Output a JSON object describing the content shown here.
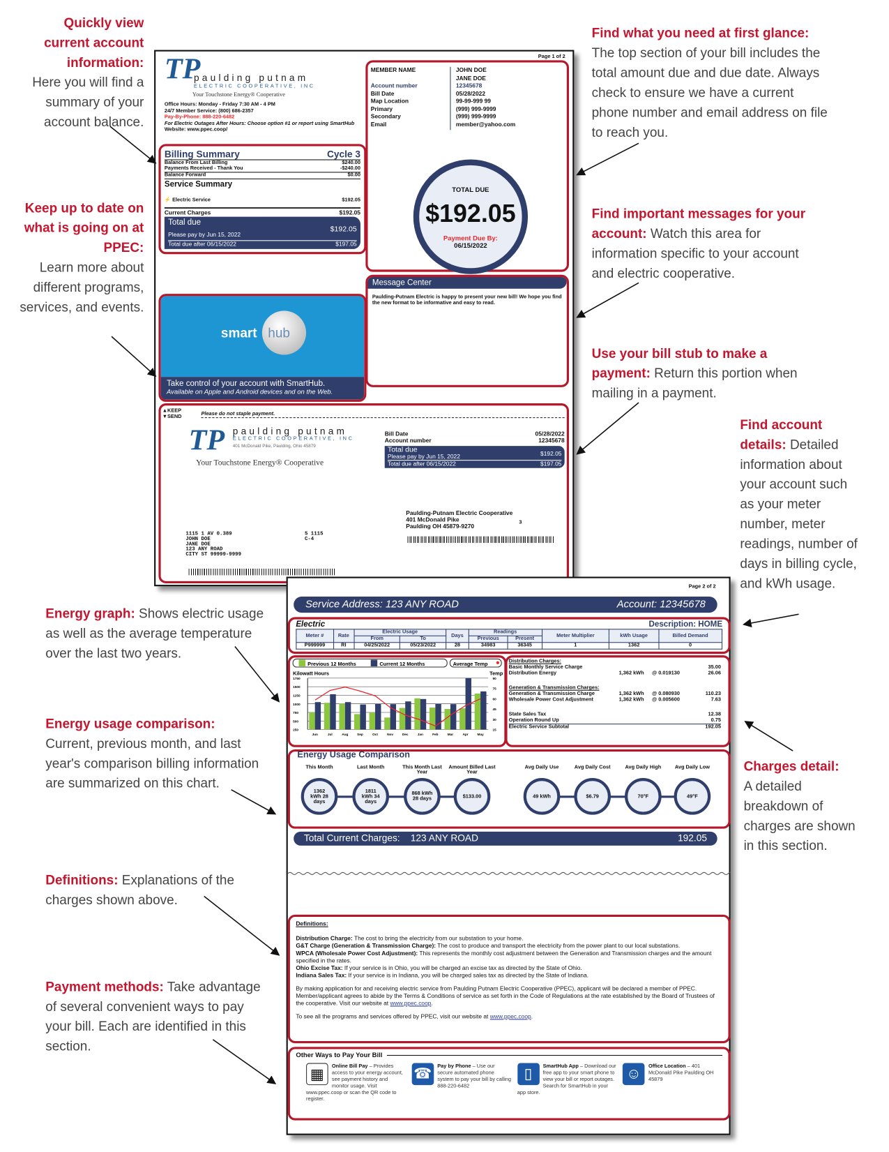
{
  "annotations": {
    "account": {
      "heading": "Quickly view current account information:",
      "text": "Here you will find a summary of your account balance."
    },
    "ppec": {
      "heading": "Keep up to date on what is going on at PPEC:",
      "text": "Learn more about different programs, services, and events."
    },
    "glance": {
      "heading": "Find what you need at first glance:",
      "text": "The top section of your bill includes the total amount due and due date. Always check to ensure we have a current phone number and email address on file to reach you."
    },
    "messages": {
      "heading": "Find important messages for your account:",
      "text": "Watch this area for information specific to your account and electric cooperative."
    },
    "stub": {
      "heading": "Use your bill stub to make a payment:",
      "text": "Return this portion when mailing in a payment."
    },
    "details": {
      "heading": "Find account details:",
      "text": "Detailed information about your account such as your meter number, meter readings, number of days in billing cycle, and kWh usage."
    },
    "graph": {
      "heading": "Energy graph:",
      "text": "Shows electric usage as well as the average temperature over the last two years."
    },
    "comparison": {
      "heading": "Energy usage comparison:",
      "text": "Current, previous month, and last year's comparison billing information are summarized on this chart."
    },
    "charges": {
      "heading": "Charges detail:",
      "text": "A detailed breakdown of charges are shown in this section."
    },
    "definitions": {
      "heading": "Definitions:",
      "text": "Explanations of the charges shown above."
    },
    "payment": {
      "heading": "Payment methods:",
      "text": "Take advantage of several convenient ways to pay your bill. Each are identified in this section."
    }
  },
  "colors": {
    "accent_red": "#b5172b",
    "navy": "#2f3e6b",
    "logo_blue": "#1f5a94",
    "smarthub_blue": "#1e96d3",
    "prev_green": "#8cc63f"
  },
  "page1": {
    "page_label": "Page 1 of 2",
    "logo": {
      "name": "paulding putnam",
      "sub": "ELECTRIC COOPERATIVE, INC",
      "tagline": "Your Touchstone Energy® Cooperative"
    },
    "office_hours": "Office Hours: Monday - Friday 7:30 AM - 4 PM",
    "member_service": "24/7 Member Service: (800) 686-2357",
    "pay_by_phone": "Pay-By-Phone: 888-220-6482",
    "outages": "For Electric Outages After Hours: Choose option #1 or report using SmartHub",
    "website": "Website: www.ppec.coop/",
    "member": {
      "rows": [
        {
          "label": "MEMBER NAME",
          "value": "JOHN DOE"
        },
        {
          "label": "",
          "value": "JANE DOE"
        },
        {
          "label": "Account number",
          "value": "12345678"
        },
        {
          "label": "Bill Date",
          "value": "05/28/2022"
        },
        {
          "label": "Map Location",
          "value": "99-99-999 99"
        },
        {
          "label": "Primary",
          "value": "(999) 999-9999"
        },
        {
          "label": "Secondary",
          "value": "(999) 999-9999"
        },
        {
          "label": "Email",
          "value": "member@yahoo.com"
        }
      ]
    },
    "total_due": {
      "label": "TOTAL DUE",
      "amount": "$192.05",
      "due_label": "Payment Due By:",
      "due_date": "06/15/2022"
    },
    "billing": {
      "title": "Billing Summary",
      "cycle": "Cycle 3",
      "lines": [
        {
          "label": "Balance From Last Billing",
          "value": "$240.00"
        },
        {
          "label": "Payments Received - Thank You",
          "value": "-$240.00"
        },
        {
          "label": "Balance Forward",
          "value": "$0.00"
        }
      ],
      "service_title": "Service Summary",
      "service": {
        "label": "Electric Service",
        "value": "$192.05"
      },
      "current": {
        "label": "Current Charges",
        "value": "$192.05"
      },
      "total_label": "Total due",
      "total_value": "$192.05",
      "pay_by": "Please pay by Jun 15, 2022",
      "after_label": "Total due after 06/15/2022",
      "after_value": "$197.05"
    },
    "smarthub": {
      "word1": "smart",
      "word2": "hub",
      "line1": "Take control of your account with SmartHub.",
      "line2": "Available on Apple and Android devices and on the Web."
    },
    "message_center": {
      "title": "Message Center",
      "text": "Paulding-Putnam Electric is happy to present your new bill! We hope you find the new format to be informative and easy to read."
    },
    "stub": {
      "keep": "KEEP",
      "send": "SEND",
      "no_staple": "Please do not staple payment.",
      "address": "401 McDonald Pike, Paulding, Ohio 45879",
      "bill_date_label": "Bill Date",
      "bill_date": "05/28/2022",
      "account_label": "Account number",
      "account": "12345678",
      "total_label": "Total due",
      "total_value": "$192.05",
      "pay_by": "Please pay by Jun 15, 2022",
      "after_label": "Total due after 06/15/2022",
      "after_value": "$197.05",
      "remit": [
        "Paulding-Putnam Electric Cooperative",
        "401 McDonald Pike",
        "Paulding OH 45879-9270"
      ],
      "remit_code": "3",
      "mail": [
        "1115  1 AV 0.389",
        "JOHN DOE",
        "JANE DOE",
        "123 ANY ROAD",
        "CITY ST 99999-9999"
      ],
      "mail_code": [
        "5 1115",
        "C-4"
      ]
    }
  },
  "page2": {
    "page_label": "Page 2 of 2",
    "service_address": "Service Address: 123 ANY ROAD",
    "account": "Account: 12345678",
    "electric": {
      "title": "Electric",
      "description": "Description: HOME",
      "headers": {
        "meter": "Meter #",
        "rate": "Rate",
        "usage": "Electric Usage",
        "from": "From",
        "to": "To",
        "days": "Days",
        "readings": "Readings",
        "previous": "Previous",
        "present": "Present",
        "multiplier": "Meter Multiplier",
        "kwh": "kWh Usage",
        "demand": "Billed Demand"
      },
      "values": {
        "meter": "P999999",
        "rate": "RI",
        "from": "04/25/2022",
        "to": "05/23/2022",
        "days": "28",
        "previous": "34983",
        "present": "36345",
        "multiplier": "1",
        "kwh": "1362",
        "demand": "0"
      }
    },
    "charges": {
      "dist_title": "Distribution Charges:",
      "dist": [
        {
          "label": "Basic Monthly Service Charge",
          "qty": "",
          "rate": "",
          "value": "35.00"
        },
        {
          "label": "Distribution Energy",
          "qty": "1,362 kWh",
          "rate": "@ 0.019130",
          "value": "26.06"
        }
      ],
      "gt_title": "Generation & Transmission Charges:",
      "gt": [
        {
          "label": "Generation & Transmission Charge",
          "qty": "1,362 kWh",
          "rate": "@ 0.080930",
          "value": "110.23"
        },
        {
          "label": "Wholesale Power Cost Adjustment",
          "qty": "1,362 kWh",
          "rate": "@ 0.005600",
          "value": "7.63"
        }
      ],
      "other": [
        {
          "label": "State Sales Tax",
          "value": "12.38"
        },
        {
          "label": "Operation Round Up",
          "value": "0.75"
        }
      ],
      "subtotal": {
        "label": "Electric Service Subtotal",
        "value": "192.05"
      }
    },
    "comparison": {
      "title": "Energy Usage Comparison",
      "items": [
        {
          "label": "This Month",
          "value": "1362 kWh 28 days"
        },
        {
          "label": "Last Month",
          "value": "1811 kWh 34 days"
        },
        {
          "label": "This Month Last Year",
          "value": "868 kWh 28 days"
        },
        {
          "label": "Amount Billed Last Year",
          "value": "$133.00"
        },
        {
          "label": "Avg Daily Use",
          "value": "49 kWh"
        },
        {
          "label": "Avg Daily Cost",
          "value": "$6.79"
        },
        {
          "label": "Avg Daily High",
          "value": "70°F"
        },
        {
          "label": "Avg Daily Low",
          "value": "49°F"
        }
      ]
    },
    "total_charges": {
      "label": "Total Current Charges:",
      "address": "123 ANY ROAD",
      "value": "192.05"
    },
    "definitions": {
      "title": "Definitions:",
      "items": [
        {
          "term": "Distribution Charge:",
          "text": " The cost to bring the electricity from our substation to your home."
        },
        {
          "term": "G&T Charge (Generation & Transmission Charge):",
          "text": " The cost to produce and transport the electricity from the power plant to our local substations."
        },
        {
          "term": "WPCA (Wholesale Power Cost Adjustment):",
          "text": " This represents the monthly cost adjustment between the Generation and Transmission charges and the amount specified in the rates."
        },
        {
          "term": "Ohio Excise Tax:",
          "text": " If your service is in Ohio, you will be charged an excise tax as directed by the State of Ohio."
        },
        {
          "term": "Indiana Sales Tax:",
          "text": " If your service is in Indiana, you will be charged sales tax as directed by the State of Indiana."
        }
      ],
      "membership": "By making application for and receiving electric service from Paulding Putnam Electric Cooperative (PPEC), applicant will be declared a member of PPEC. Member/applicant agrees to abide by the Terms & Conditions of service as set forth in the Code of Regulations at the rate established by the Board of Trustees of the cooperative. Visit our website at ",
      "programs": "To see all the programs and services offered by PPEC, visit our website at ",
      "link": "www.ppec.coop"
    },
    "pay": {
      "title": "Other Ways to Pay Your Bill",
      "items": [
        {
          "icon": "qr-code-icon",
          "title": "Online Bill Pay",
          "text": " – Provides access to your energy account, see payment history and monitor usage. Visit www.ppec.coop or scan the QR code to register."
        },
        {
          "icon": "phone-icon",
          "title": "Pay by Phone",
          "text": " – Use our secure automated phone system to pay your bill by calling 888-220-6482"
        },
        {
          "icon": "smartphone-icon",
          "title": "SmartHub App",
          "text": " – Download our free app to your smart phone to view your bill or report outages. Search for SmartHub in your app store."
        },
        {
          "icon": "person-icon",
          "title": "Office Location",
          "text": " – 401 McDonald Pike Paulding OH 45879"
        }
      ]
    }
  },
  "chart_data": {
    "type": "bar",
    "legend": [
      "Previous 12 Months",
      "Current 12 Months",
      "Average Temp"
    ],
    "ylabel": "Kilowatt Hours",
    "y2label": "Temp",
    "categories": [
      "Jun",
      "Jul",
      "Aug",
      "Sep",
      "Oct",
      "Nov",
      "Dec",
      "Jan",
      "Feb",
      "Mar",
      "Apr",
      "May"
    ],
    "ylim": [
      250,
      1750
    ],
    "yticks": [
      1750,
      1500,
      1250,
      1000,
      750,
      500,
      250
    ],
    "y2lim": [
      15,
      90
    ],
    "y2ticks": [
      90,
      75,
      60,
      45,
      30,
      15
    ],
    "series": [
      {
        "name": "Previous 12 Months",
        "color": "#8cc63f",
        "values": [
          750,
          1030,
          1000,
          700,
          750,
          600,
          880,
          1160,
          890,
          850,
          870,
          1300
        ]
      },
      {
        "name": "Current 12 Months",
        "color": "#2f3e6b",
        "values": [
          1050,
          1280,
          1050,
          980,
          1000,
          990,
          1070,
          1140,
          1000,
          990,
          1750,
          1362
        ]
      },
      {
        "name": "Average Temp",
        "color": "#e8262b",
        "type": "line",
        "axis": "right",
        "values": [
          58,
          72,
          77,
          71,
          64,
          47,
          36,
          29,
          20,
          36,
          50,
          60
        ]
      }
    ],
    "grid": true,
    "legend_position": "top"
  }
}
